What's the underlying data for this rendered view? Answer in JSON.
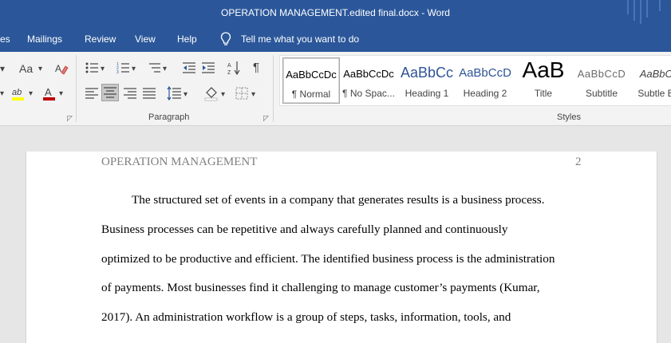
{
  "titlebar": {
    "title": "OPERATION MANAGEMENT.edited final.docx  -  Word"
  },
  "tabs": {
    "partial": "es",
    "mailings": "Mailings",
    "review": "Review",
    "view": "View",
    "help": "Help"
  },
  "tellme": {
    "text": "Tell me what you want to do"
  },
  "ribbon": {
    "font_case": "Aa",
    "paragraph_label": "Paragraph",
    "styles_label": "Styles",
    "styles": [
      {
        "preview": "AaBbCcDc",
        "label": "¶ Normal"
      },
      {
        "preview": "AaBbCcDc",
        "label": "¶ No Spac..."
      },
      {
        "preview": "AaBbCc",
        "label": "Heading 1"
      },
      {
        "preview": "AaBbCcD",
        "label": "Heading 2"
      },
      {
        "preview": "AaB",
        "label": "Title"
      },
      {
        "preview": "AaBbCcD",
        "label": "Subtitle"
      },
      {
        "preview": "AaBbCcl",
        "label": "Subtle Em"
      }
    ]
  },
  "document": {
    "header_left": "OPERATION MANAGEMENT",
    "page_number": "2",
    "lines": [
      "The structured set of events in a company that generates results is a business process.",
      "Business processes can be repetitive and always carefully planned and continuously",
      "optimized to be productive and efficient. The identified business process is the administration",
      "of payments. Most businesses find it challenging to manage customer’s payments (Kumar,",
      "2017).  An administration workflow is a group of steps, tasks, information, tools, and"
    ]
  },
  "colors": {
    "accent": "#2b579a",
    "heading_blue": "#2f5496"
  }
}
